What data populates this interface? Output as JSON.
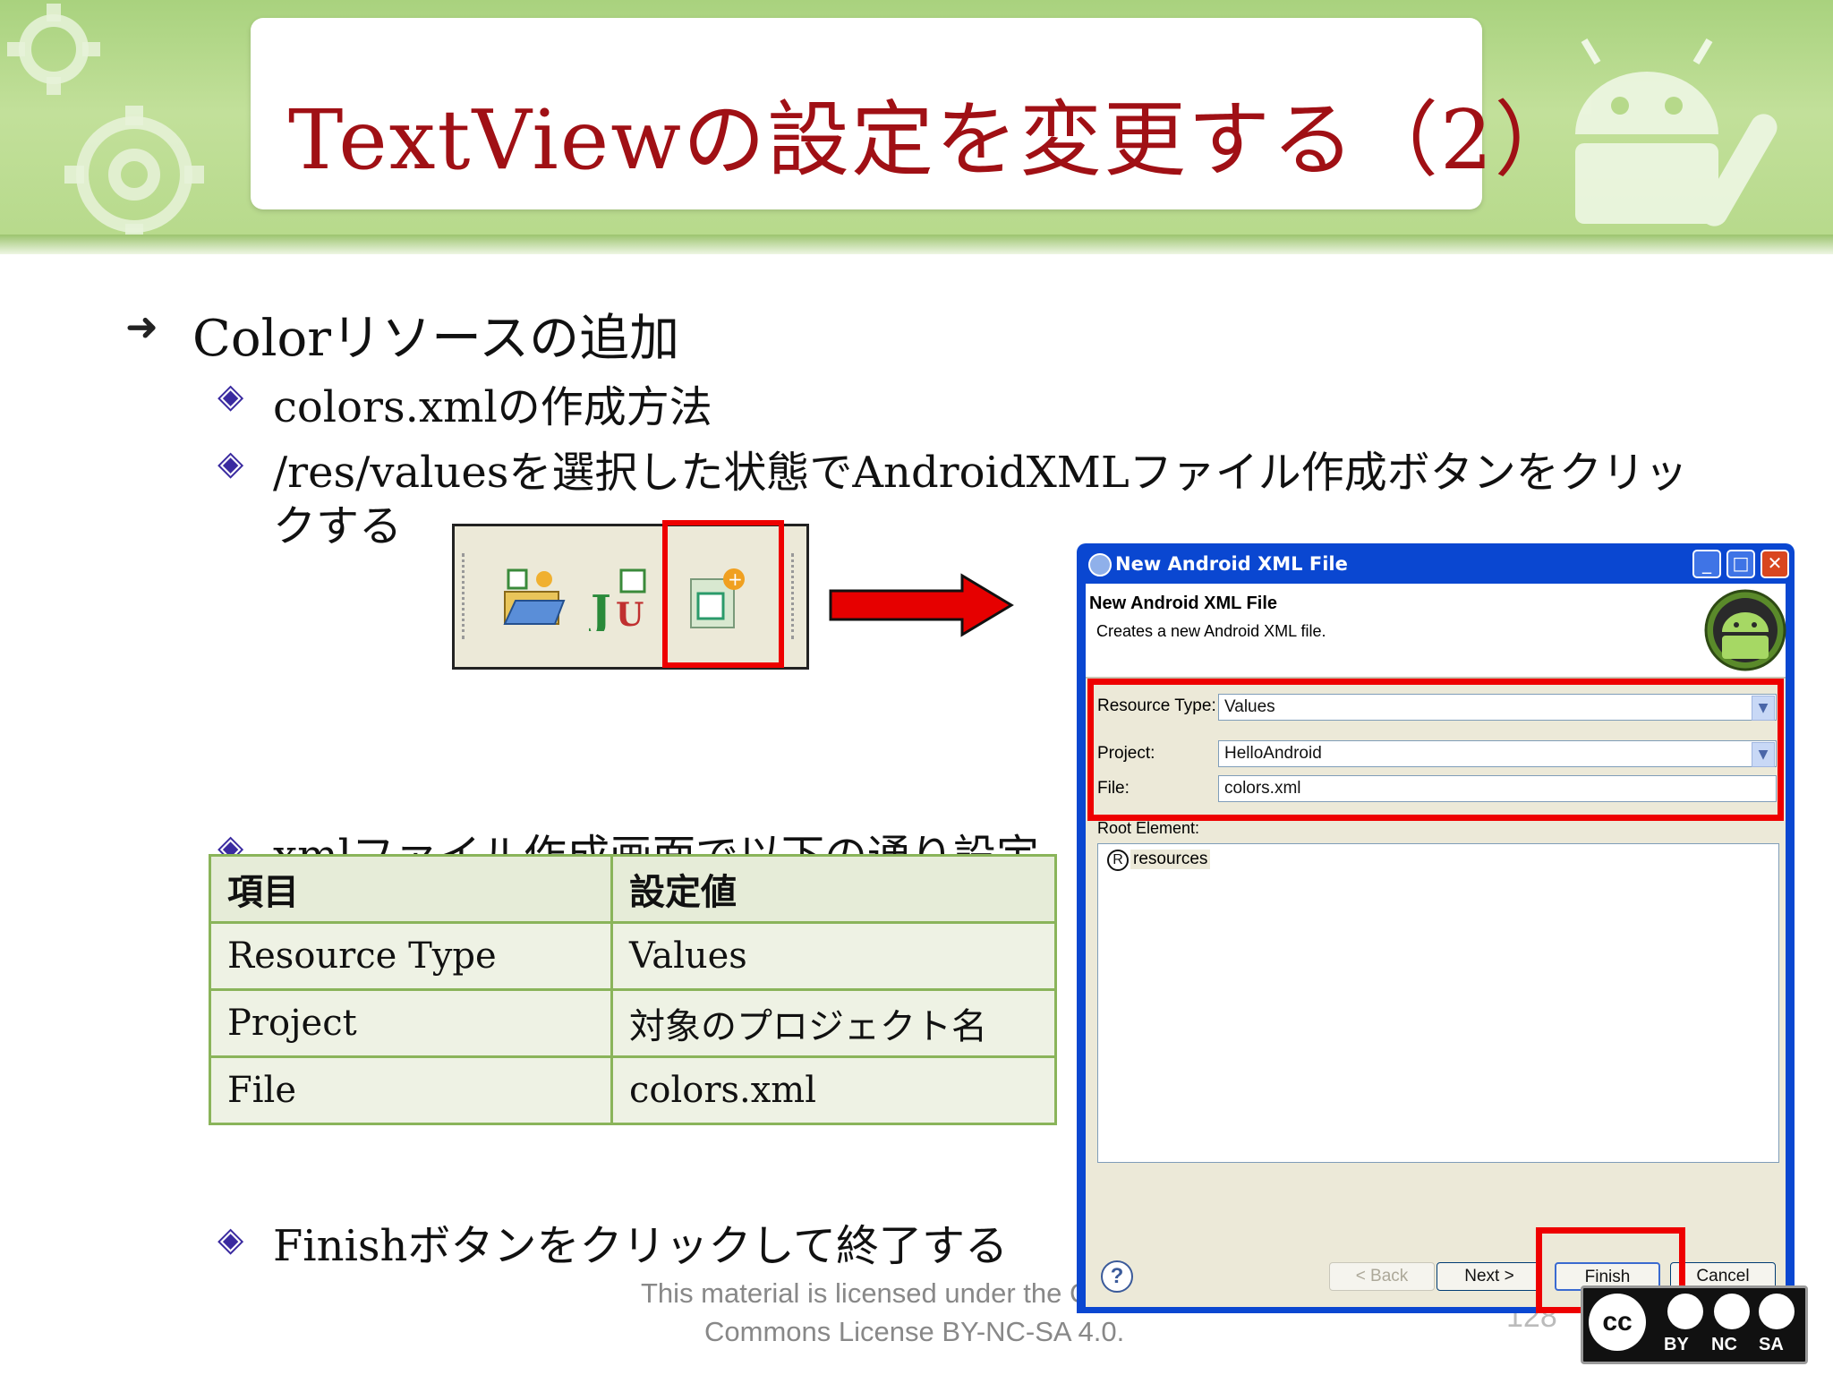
{
  "slide": {
    "title": "TextViewの設定を変更する（2）",
    "bullet1": "Colorリソースの追加",
    "sub1": "colors.xmlの作成方法",
    "sub2_line1": " /res/valuesを選択した状態でAndroidXMLファイル作成ボタンをクリッ",
    "sub2_line2": "クする",
    "sub3": "xmlファイル作成画面で以下の通り設定",
    "sub4": "Finishボタンをクリックして終了する",
    "page_number": "128"
  },
  "table": {
    "header": [
      "項目",
      "設定値"
    ],
    "rows": [
      [
        "Resource Type",
        "Values"
      ],
      [
        "Project",
        "対象のプロジェクト名"
      ],
      [
        "File",
        "colors.xml"
      ]
    ]
  },
  "dialog": {
    "window_title": "New Android XML File",
    "heading": "New Android XML File",
    "description": "Creates a new Android XML file.",
    "resource_type_label": "Resource Type:",
    "resource_type_value": "Values",
    "project_label": "Project:",
    "project_value": "HelloAndroid",
    "file_label": "File:",
    "file_value": "colors.xml",
    "root_element_label": "Root Element:",
    "root_element_item": "resources",
    "root_element_badge": "R",
    "buttons": {
      "back": "< Back",
      "next": "Next >",
      "finish": "Finish",
      "cancel": "Cancel"
    },
    "help_symbol": "?"
  },
  "footer": {
    "license_line1": "This material is licensed under the Creative",
    "license_line2": "Commons License BY-NC-SA 4.0.",
    "cc_by": "BY",
    "cc_nc": "NC",
    "cc_sa": "SA"
  },
  "colors": {
    "title_red": "#a01015",
    "highlight_red": "#ee0000",
    "banner_green": "#b6d98a",
    "xp_blue": "#0a47d1"
  },
  "icons": [
    "gear-icon",
    "android-robot-icon",
    "new-project-icon",
    "junit-icon",
    "new-xml-file-icon",
    "arrow-right-icon",
    "help-icon",
    "android-logo-icon",
    "cc-logo-icon"
  ]
}
